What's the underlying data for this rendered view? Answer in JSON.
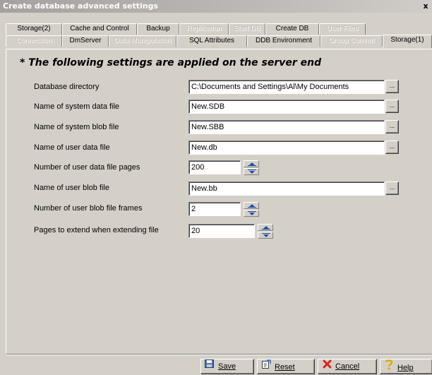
{
  "window": {
    "title": "Create database advanced settings",
    "close_glyph": "x"
  },
  "tabs_row1": [
    {
      "label": "Storage(2)",
      "enabled": true
    },
    {
      "label": "Cache and Control",
      "enabled": true
    },
    {
      "label": "Backup",
      "enabled": true
    },
    {
      "label": "Replication",
      "enabled": false
    },
    {
      "label": "Start DB",
      "enabled": false
    },
    {
      "label": "Create DB",
      "enabled": true
    },
    {
      "label": "User Files",
      "enabled": false
    }
  ],
  "tabs_row2": [
    {
      "label": "Connection",
      "enabled": false
    },
    {
      "label": "DmServer",
      "enabled": true
    },
    {
      "label": "Data Manipulation",
      "enabled": false
    },
    {
      "label": "SQL Attributes",
      "enabled": true
    },
    {
      "label": "DDB Environment",
      "enabled": true
    },
    {
      "label": "Group Commit",
      "enabled": false
    },
    {
      "label": "Storage(1)",
      "enabled": true,
      "active": true
    }
  ],
  "heading": "* The following settings are applied on the server end",
  "fields": [
    {
      "label": "Database directory",
      "value": "C:\\Documents and Settings\\Al\\My Documents",
      "control": "browse"
    },
    {
      "label": "Name of system data file",
      "value": "New.SDB",
      "control": "browse"
    },
    {
      "label": "Name of system blob file",
      "value": "New.SBB",
      "control": "browse"
    },
    {
      "label": "Name of user data file",
      "value": "New.db",
      "control": "browse"
    },
    {
      "label": "Number of user data file pages",
      "value": "200",
      "control": "spinner"
    },
    {
      "label": "Name of user blob file",
      "value": "New.bb",
      "control": "browse"
    },
    {
      "label": "Number of user blob file frames",
      "value": "2",
      "control": "spinner"
    },
    {
      "label": "Pages to extend when extending file",
      "value": "20",
      "control": "spinner"
    }
  ],
  "browse_label": "...",
  "buttons": {
    "save": {
      "label": "Save",
      "icon": "save-icon"
    },
    "reset": {
      "label": "Reset",
      "icon": "reset-icon"
    },
    "cancel": {
      "label": "Cancel",
      "icon": "cancel-icon"
    },
    "help": {
      "label": "Help",
      "icon": "help-icon"
    }
  },
  "colors": {
    "background": "#d4d0c8",
    "cancel_icon": "#e02020",
    "help_icon": "#f0c000"
  }
}
